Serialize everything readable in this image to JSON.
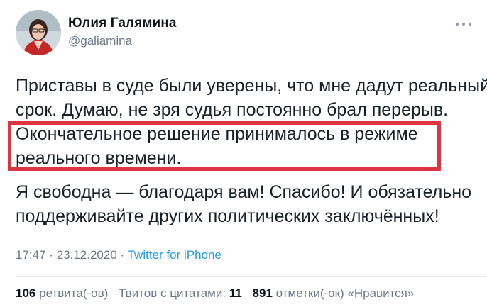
{
  "author": {
    "name": "Юлия Галямина",
    "handle": "@galiamina"
  },
  "tweet": {
    "line1": "Приставы в суде были уверены, что мне дадут реальный",
    "line2": "срок. Думаю, не зря судья постоянно брал перерыв.",
    "line3": "Окончательное решение принималось в режиме",
    "line4": "реального времени.",
    "line5": "Я свободна — благодаря вам! Спасибо! И обязательно",
    "line6": "поддерживайте других политических заключённых!"
  },
  "meta": {
    "time": "17:47",
    "separator": "·",
    "date": "23.12.2020",
    "source": "Twitter for iPhone"
  },
  "stats": {
    "retweets_count": "106",
    "retweets_label": "ретвита(-ов)",
    "quotes_label": "Твитов с цитатами:",
    "quotes_count": "11",
    "likes_count": "891",
    "likes_label": "отметки(-ок) «Нравится»"
  },
  "colors": {
    "highlight_border": "#dd3442",
    "link": "#1d9bf0",
    "muted": "#6b7886"
  },
  "icons": {
    "more": "more-dots-icon"
  }
}
